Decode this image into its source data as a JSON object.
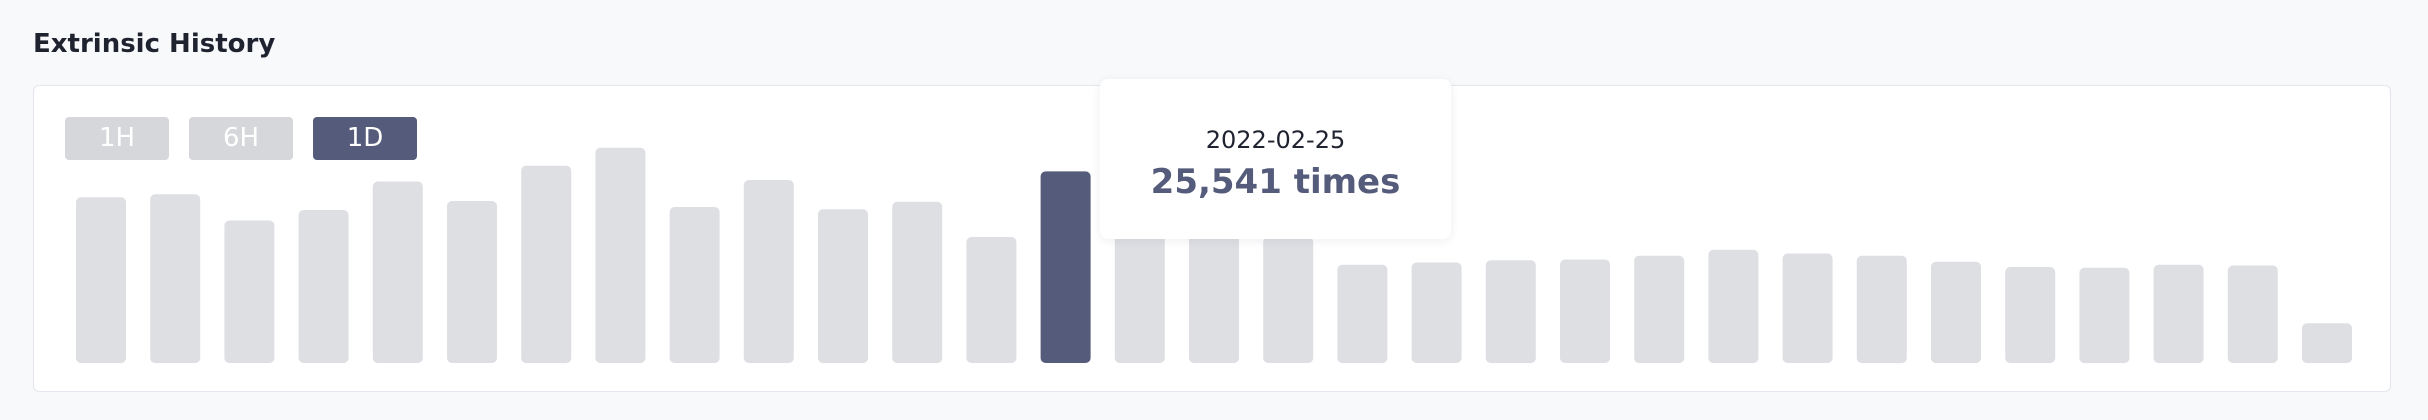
{
  "section": {
    "title": "Extrinsic History"
  },
  "range_tabs": [
    {
      "label": "1H",
      "active": false
    },
    {
      "label": "6H",
      "active": false
    },
    {
      "label": "1D",
      "active": true
    }
  ],
  "tooltip": {
    "date": "2022-02-25",
    "value": "25,541",
    "unit": "times"
  },
  "colors": {
    "bar": "#dedfe3",
    "bar_highlight": "#555b7a",
    "tab_inactive": "#d6d7da",
    "tab_active": "#555b7a",
    "accent_text": "#555b7a"
  },
  "chart_data": {
    "type": "bar",
    "categories": [],
    "values": [
      22100,
      22500,
      19000,
      20400,
      24200,
      21600,
      26300,
      28700,
      20800,
      24400,
      20500,
      21500,
      16800,
      25541,
      22000,
      22000,
      16800,
      13100,
      13400,
      13700,
      13800,
      14300,
      15100,
      14600,
      14300,
      13500,
      12800,
      12700,
      13100,
      13000,
      5300
    ],
    "highlight_index": 13,
    "ylim": [
      0,
      32000
    ],
    "xlabel": "",
    "ylabel": "",
    "title": "",
    "grid": false,
    "legend": "none"
  }
}
